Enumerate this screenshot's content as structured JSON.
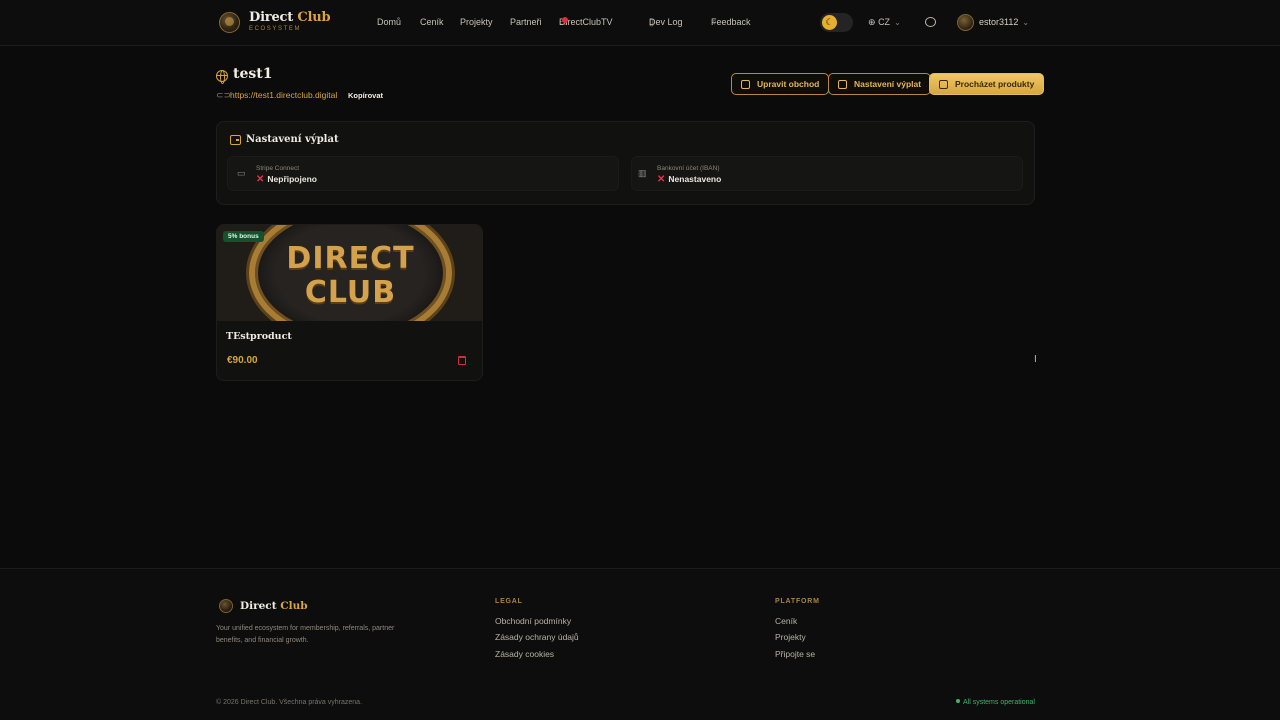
{
  "brand": {
    "name_main": "Direct",
    "name_accent": "Club",
    "tagline": "ECOSYSTEM"
  },
  "nav": {
    "items": [
      "Domů",
      "Ceník",
      "Projekty",
      "Partneři",
      "DirectClubTV",
      "Dev Log",
      "Feedback"
    ],
    "language": "CZ",
    "username": "estor3112"
  },
  "store": {
    "title": "test1",
    "url": "https://test1.directclub.digital",
    "copy_label": "Kopírovat",
    "buttons": {
      "edit": "Upravit obchod",
      "payout": "Nastavení výplat",
      "browse": "Procházet produkty"
    }
  },
  "payout": {
    "title": "Nastavení výplat",
    "stripe_label": "Stripe Connect",
    "stripe_value": "Nepřipojeno",
    "bank_label": "Bankovní účet (IBAN)",
    "bank_value": "Nenastaveno"
  },
  "product": {
    "badge": "5% bonus",
    "image_text_line1": "DIRECT",
    "image_text_line2": "CLUB",
    "name": "TEstproduct",
    "price": "€90.00"
  },
  "footer": {
    "brand_main": "Direct",
    "brand_accent": "Club",
    "description": "Your unified ecosystem for membership, referrals, partner benefits, and financial growth.",
    "legal_heading": "LEGAL",
    "legal_links": [
      "Obchodní podmínky",
      "Zásady ochrany údajů",
      "Zásady cookies"
    ],
    "platform_heading": "PLATFORM",
    "platform_links": [
      "Ceník",
      "Projekty",
      "Připojte se"
    ],
    "copyright": "© 2026 Direct Club. Všechna práva vyhrazena.",
    "status": "All systems operational"
  },
  "colors": {
    "accent": "#d8a53f",
    "background": "#0b0b0b",
    "error": "#e2344a",
    "success": "#3fb46a"
  }
}
